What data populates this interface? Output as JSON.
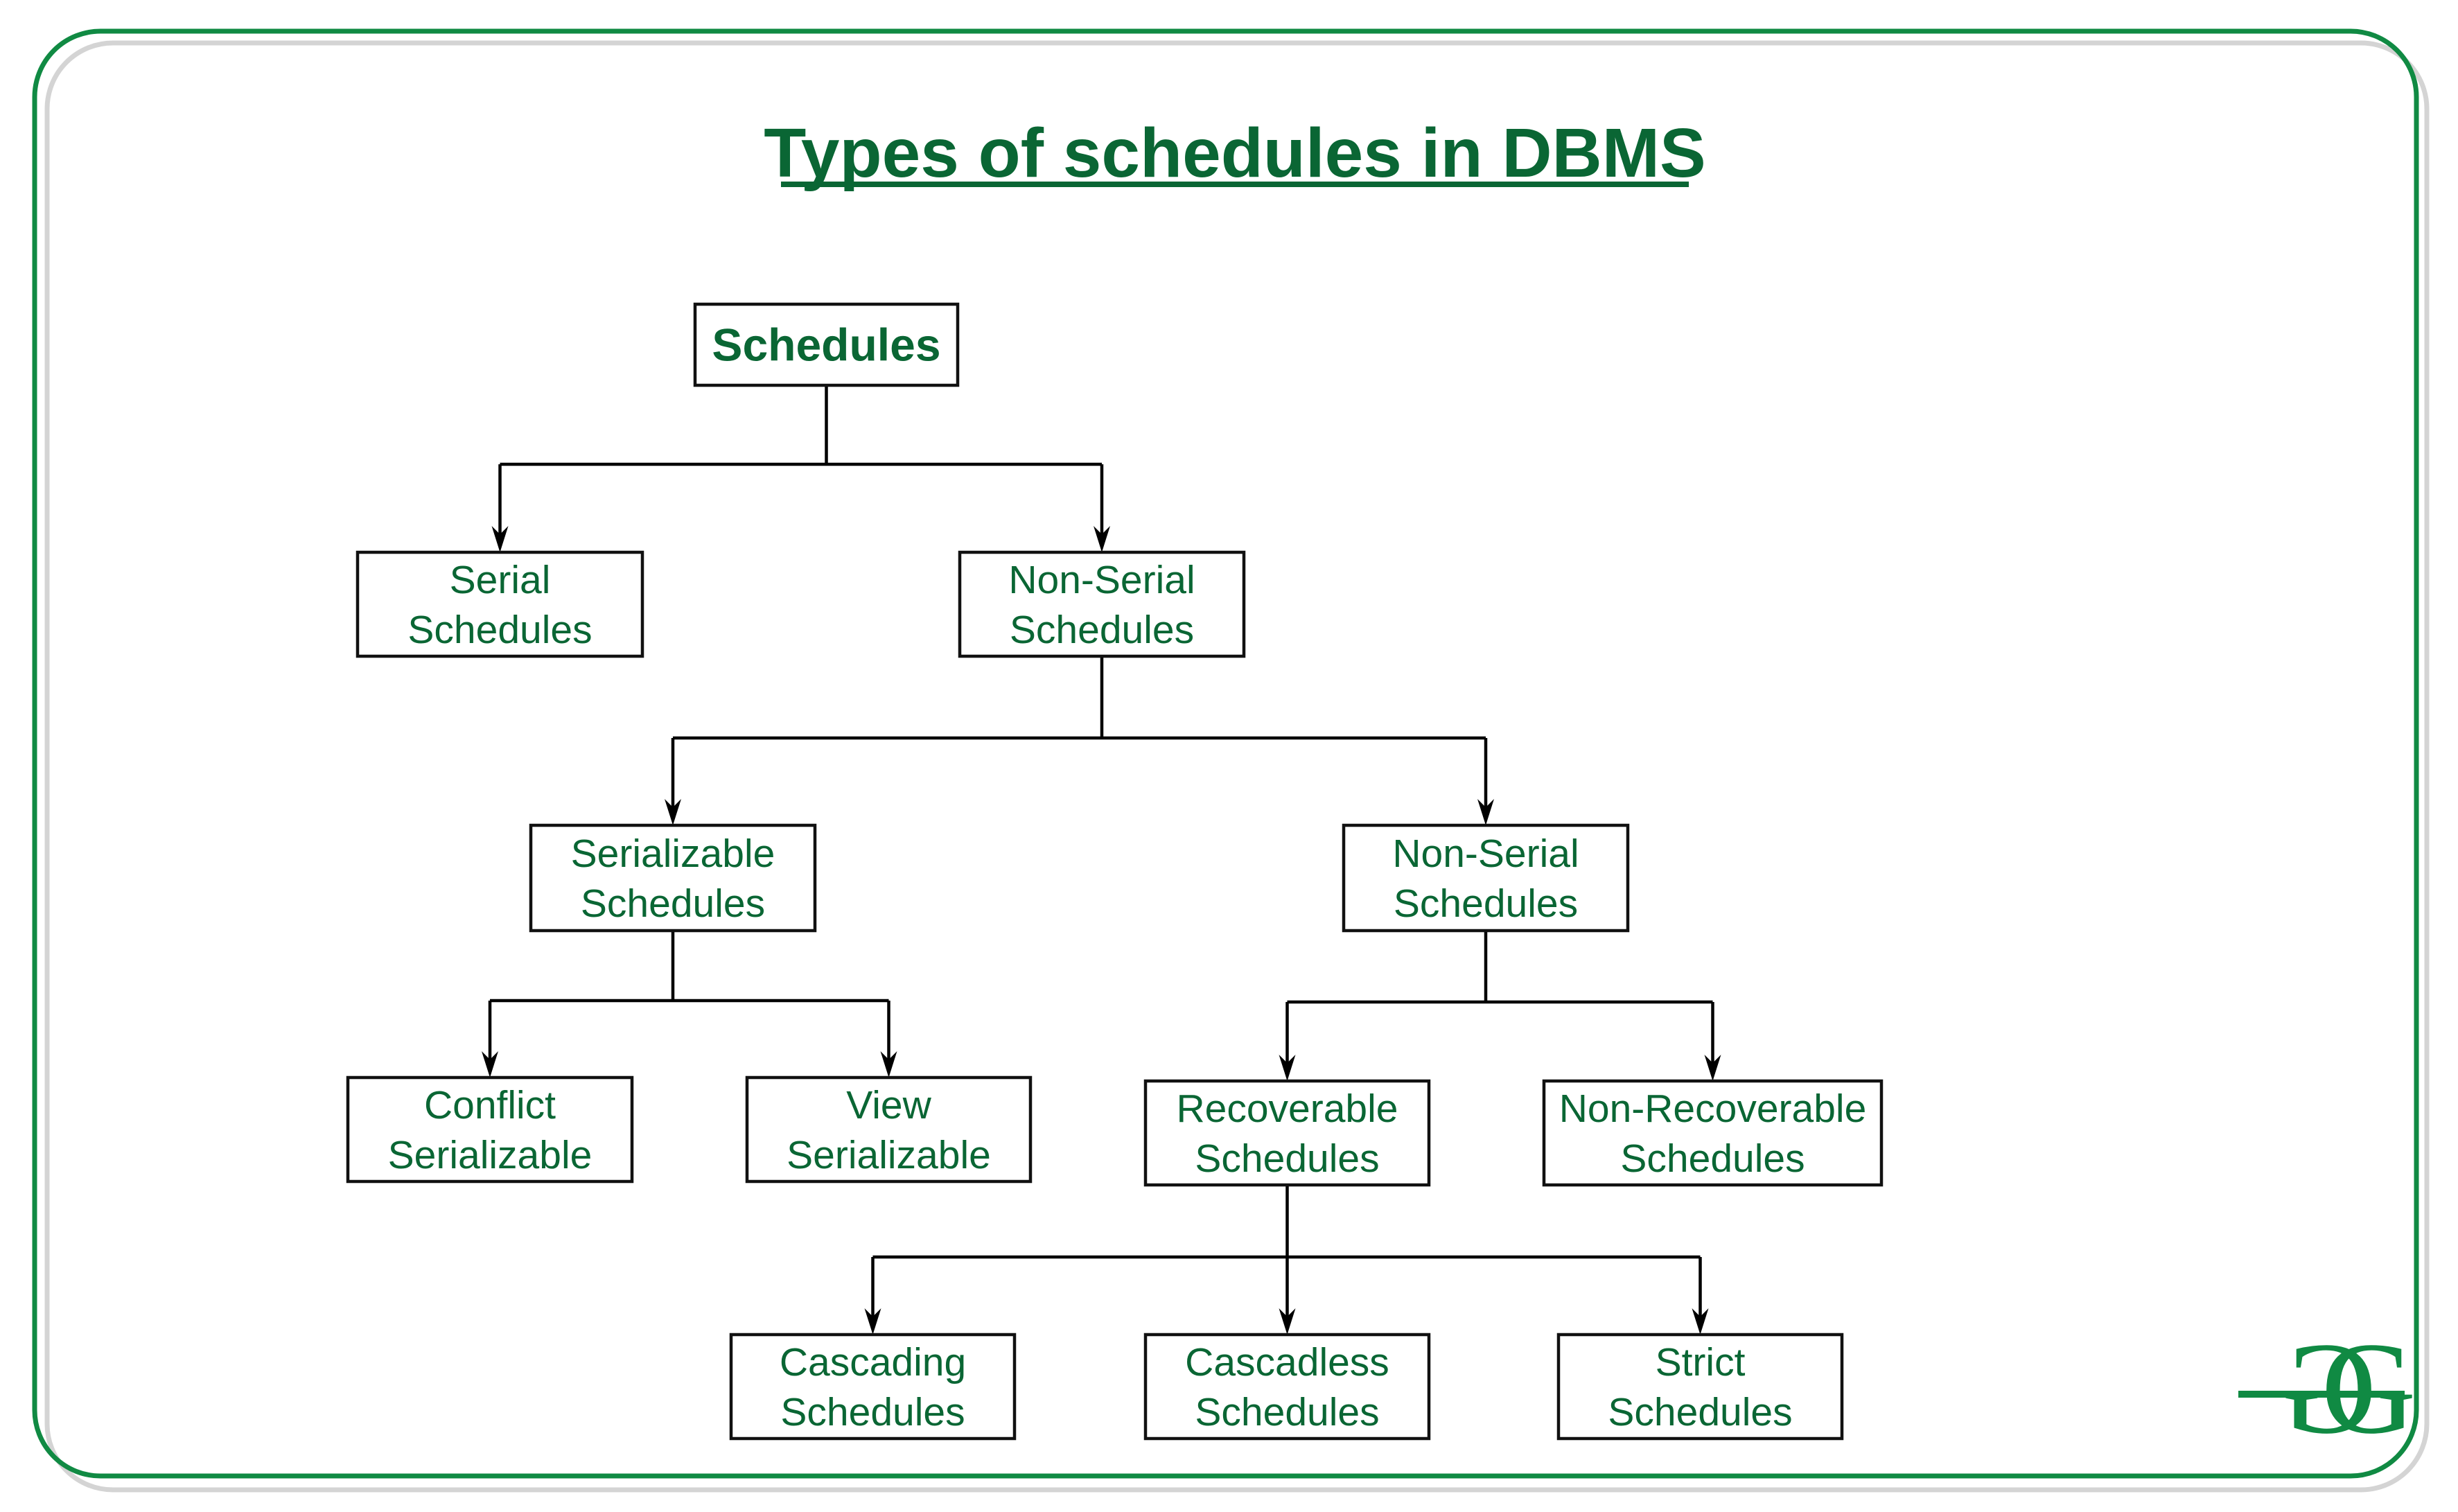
{
  "title": "Types of schedules in DBMS",
  "colors": {
    "text": "#0a6634",
    "frame": "#108a43",
    "shadow": "#d4d4d4",
    "box_border": "#111111",
    "connector": "#000000"
  },
  "logo": {
    "icon": "geeksforgeeks-logo-icon",
    "text": "GG"
  },
  "tree": {
    "root": {
      "id": "schedules",
      "lines": [
        "Schedules"
      ]
    },
    "nodes": [
      {
        "id": "serial",
        "parent": "schedules",
        "lines": [
          "Serial",
          "Schedules"
        ]
      },
      {
        "id": "non-serial",
        "parent": "schedules",
        "lines": [
          "Non-Serial",
          "Schedules"
        ]
      },
      {
        "id": "serializable",
        "parent": "non-serial",
        "lines": [
          "Serializable",
          "Schedules"
        ]
      },
      {
        "id": "non-serializable",
        "parent": "non-serial",
        "lines": [
          "Non-Serial",
          "Schedules"
        ]
      },
      {
        "id": "conflict-serializable",
        "parent": "serializable",
        "lines": [
          "Conflict",
          "Serializable"
        ]
      },
      {
        "id": "view-serializable",
        "parent": "serializable",
        "lines": [
          "View",
          "Serializable"
        ]
      },
      {
        "id": "recoverable",
        "parent": "non-serializable",
        "lines": [
          "Recoverable",
          "Schedules"
        ]
      },
      {
        "id": "non-recoverable",
        "parent": "non-serializable",
        "lines": [
          "Non-Recoverable",
          "Schedules"
        ]
      },
      {
        "id": "cascading",
        "parent": "recoverable",
        "lines": [
          "Cascading",
          "Schedules"
        ]
      },
      {
        "id": "cascadless",
        "parent": "recoverable",
        "lines": [
          "Cascadless",
          "Schedules"
        ]
      },
      {
        "id": "strict",
        "parent": "recoverable",
        "lines": [
          "Strict",
          "Schedules"
        ]
      }
    ]
  }
}
